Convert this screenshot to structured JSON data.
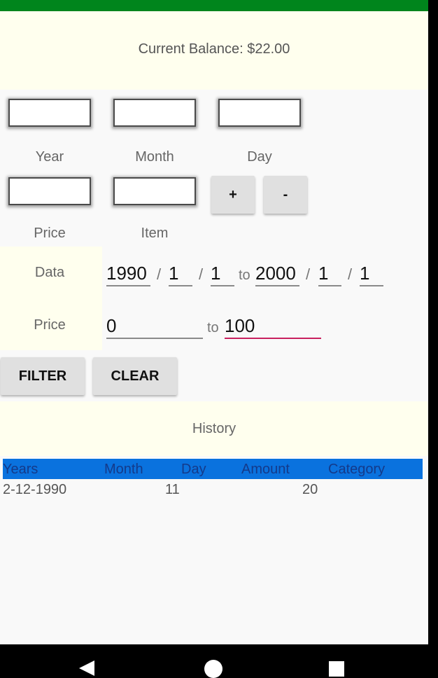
{
  "balance": {
    "text": "Current Balance: $22.00"
  },
  "labels": {
    "year": "Year",
    "month": "Month",
    "day": "Day",
    "price": "Price",
    "item": "Item"
  },
  "buttons": {
    "plus": "+",
    "minus": "-",
    "filter": "FILTER",
    "clear": "CLEAR"
  },
  "filter": {
    "data_label": "Data",
    "price_label": "Price",
    "from_year": "1990",
    "from_month": "1",
    "from_day": "1",
    "to_year": "2000",
    "to_month": "1",
    "to_day": "1",
    "date_sep": "/",
    "to_word": "to",
    "price_from": "0",
    "price_to": "100"
  },
  "history": {
    "title": "History",
    "columns": [
      "Years",
      "Month",
      "Day",
      "Amount",
      "Category"
    ],
    "rows": [
      {
        "date": "2-12-1990",
        "value_a": "11",
        "value_b": "20"
      }
    ]
  },
  "colors": {
    "status_bar": "#00851c",
    "panel": "#ffffee",
    "table_header": "#0a72de",
    "active_underline": "#c8205e"
  }
}
